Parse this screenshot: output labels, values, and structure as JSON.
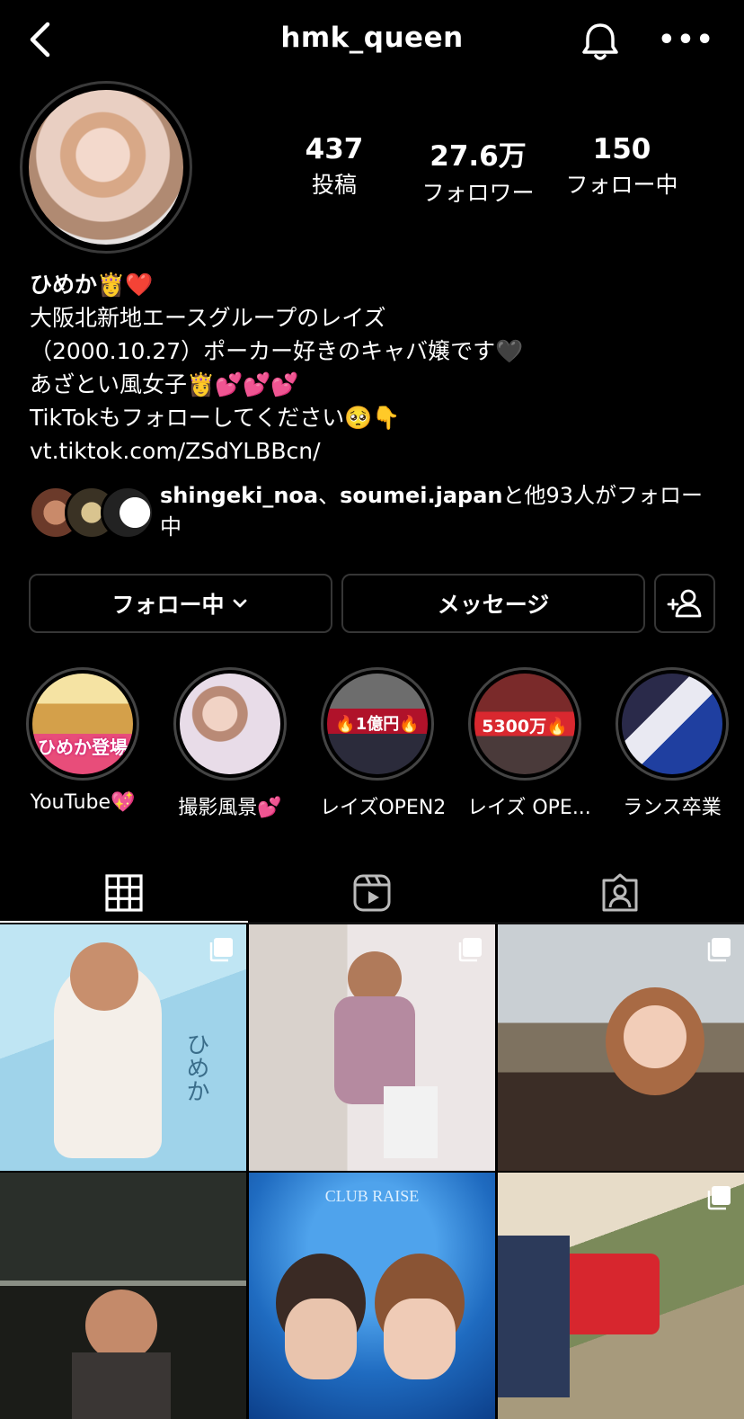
{
  "header": {
    "username": "hmk_queen",
    "back_icon": "chevron-left-icon",
    "notification_icon": "bell-icon",
    "more_label": "•••"
  },
  "stats": [
    {
      "value": "437",
      "label": "投稿"
    },
    {
      "value": "27.6万",
      "label": "フォロワー"
    },
    {
      "value": "150",
      "label": "フォロー中"
    }
  ],
  "bio": {
    "name": "ひめか👸❤️",
    "lines": [
      "大阪北新地エースグループのレイズ",
      "（2000.10.27）ポーカー好きのキャバ嬢です🖤",
      "あざとい風女子👸💕💕💕",
      "TikTokもフォローしてください🥺👇"
    ],
    "link": "vt.tiktok.com/ZSdYLBBcn/"
  },
  "followed_by": {
    "user1": "shingeki_noa",
    "sep": "、",
    "user2": "soumei.japan",
    "rest": "と他93人",
    "suffix": "がフォロー中"
  },
  "actions": {
    "following_label": "フォロー中",
    "message_label": "メッセージ",
    "add_user_icon": "add-person-icon"
  },
  "highlights": [
    {
      "label": "YouTube💖",
      "text": "ひめか登場"
    },
    {
      "label": "撮影風景💕",
      "text": ""
    },
    {
      "label": "レイズOPEN2",
      "text": "🔥1億円🔥"
    },
    {
      "label": "レイズ OPE...",
      "text": "5300万🔥"
    },
    {
      "label": "ランス卒業",
      "text": ""
    }
  ],
  "tabs": [
    {
      "name": "grid",
      "icon": "grid-icon",
      "active": true
    },
    {
      "name": "reels",
      "icon": "reels-icon",
      "active": false
    },
    {
      "name": "tagged",
      "icon": "tagged-person-icon",
      "active": false
    }
  ],
  "posts": [
    {
      "multi": true,
      "text": "ひめか"
    },
    {
      "multi": true,
      "text": ""
    },
    {
      "multi": true,
      "text": ""
    },
    {
      "multi": false,
      "text": ""
    },
    {
      "multi": false,
      "text": "CLUB RAISE"
    },
    {
      "multi": true,
      "text": ""
    }
  ],
  "colors": {
    "background": "#000000",
    "text": "#ffffff",
    "border": "#363636",
    "heart_red": "#e0245e"
  }
}
